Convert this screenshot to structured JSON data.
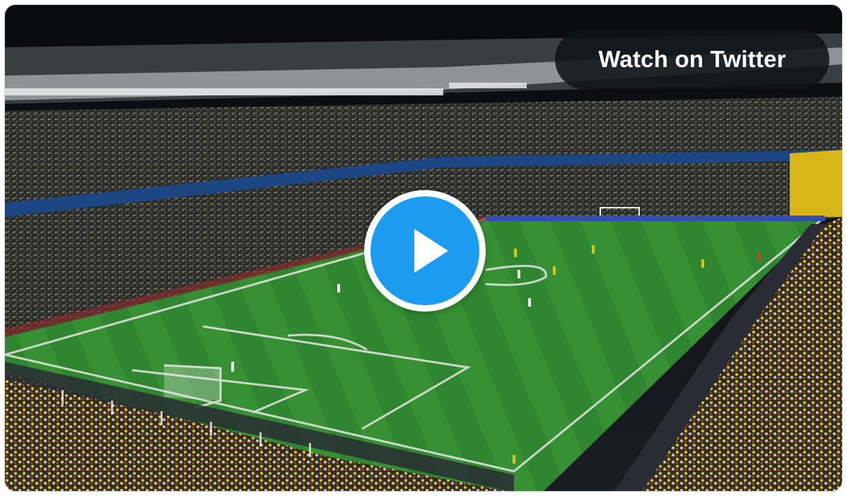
{
  "player": {
    "watch_label": "Watch on Twitter",
    "play_icon": "play-icon",
    "accent_color": "#1d9bf0"
  }
}
